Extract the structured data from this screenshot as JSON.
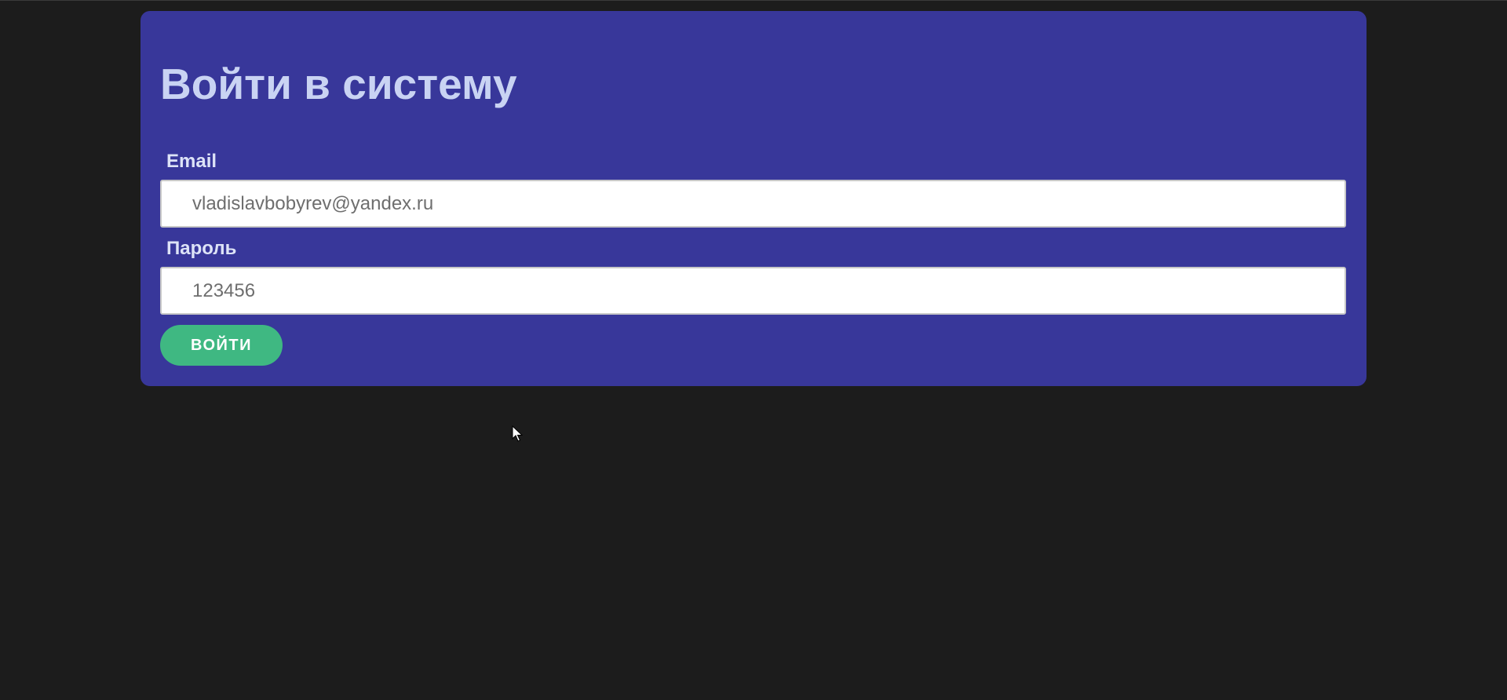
{
  "page": {
    "background": "#1c1c1c"
  },
  "login": {
    "title": "Войти в систему",
    "card_color": "#38379a",
    "email": {
      "label": "Email",
      "value": "vladislavbobyrev@yandex.ru"
    },
    "password": {
      "label": "Пароль",
      "value": "123456"
    },
    "submit": {
      "label": "ВОЙТИ",
      "color": "#3fb882"
    }
  },
  "cursor": {
    "icon": "mouse-pointer-icon"
  }
}
